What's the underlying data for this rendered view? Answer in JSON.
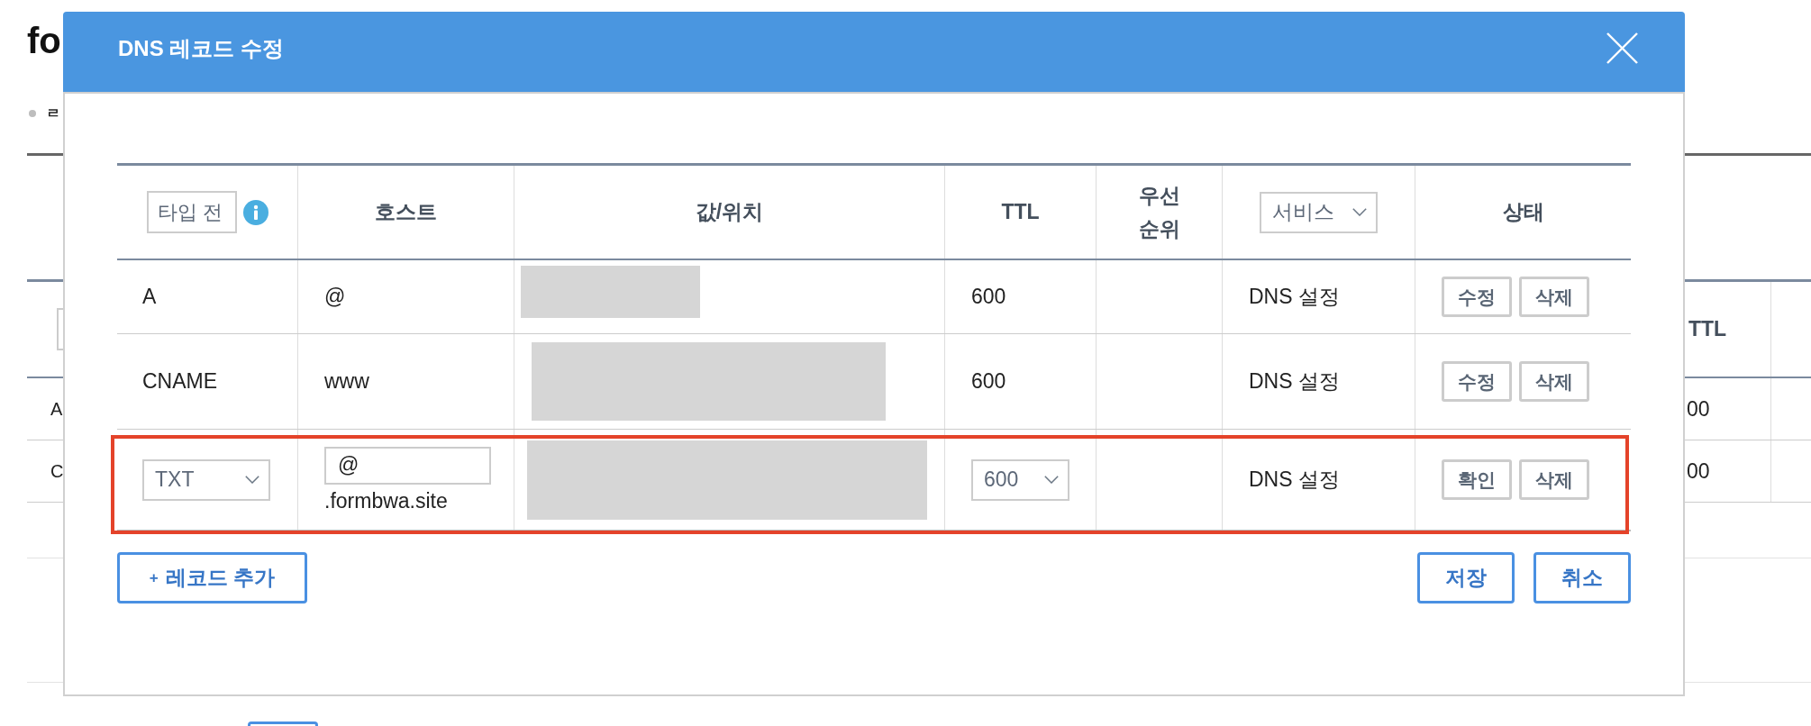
{
  "background_page": {
    "title": "fo",
    "tab_label": "ㄹ",
    "table": {
      "column_last": "TTL",
      "rows": [
        {
          "column_1": "A",
          "ttl": "00"
        },
        {
          "column_1": "C",
          "ttl": "00"
        }
      ]
    }
  },
  "dialog": {
    "title": "DNS 레코드 수정",
    "table": {
      "columns": [
        {
          "kind": "filter",
          "value": "타입 전",
          "info": true
        },
        {
          "kind": "text",
          "label": "호스트"
        },
        {
          "kind": "text",
          "label": "값/위치"
        },
        {
          "kind": "text",
          "label": "TTL"
        },
        {
          "kind": "text",
          "label": "우선\n순위"
        },
        {
          "kind": "select",
          "value": "서비스"
        },
        {
          "kind": "text",
          "label": "상태"
        }
      ],
      "rows": [
        {
          "editing": false,
          "highlighted": false,
          "type": "A",
          "host": "@",
          "value": {
            "kind": "redacted"
          },
          "ttl": "600",
          "service": "DNS 설정",
          "actions": [
            "수정",
            "삭제"
          ]
        },
        {
          "editing": false,
          "highlighted": false,
          "type": "CNAME",
          "host": "www",
          "value": {
            "kind": "redacted"
          },
          "ttl": "600",
          "service": "DNS 설정",
          "actions": [
            "수정",
            "삭제"
          ]
        },
        {
          "editing": true,
          "highlighted": true,
          "type": "TXT",
          "host": "@",
          "host_suffix": ".formbwa.site",
          "value": {
            "kind": "redacted"
          },
          "ttl": "600",
          "service": "DNS 설정",
          "actions": [
            "확인",
            "삭제"
          ]
        }
      ]
    },
    "add_button": {
      "icon_text": "+",
      "label": "레코드 추가"
    },
    "buttons": [
      "저장",
      "취소"
    ]
  }
}
